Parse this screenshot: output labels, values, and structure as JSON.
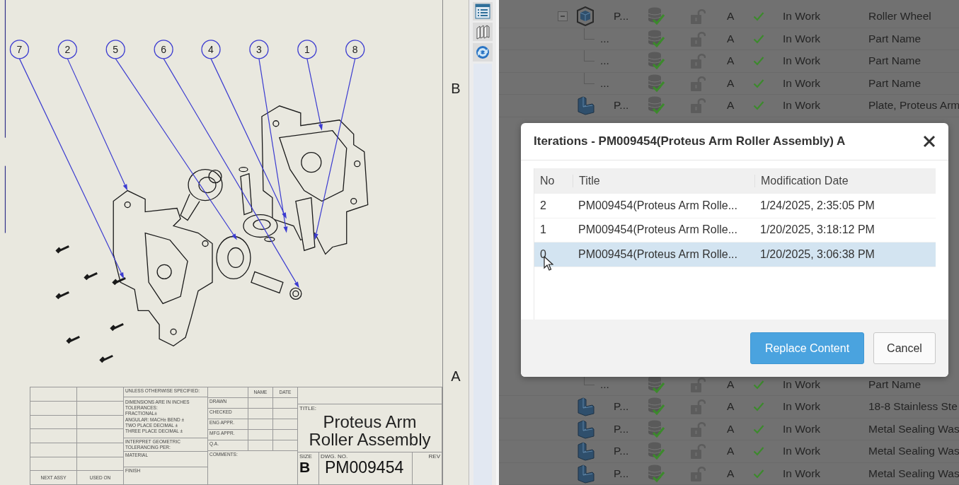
{
  "drawing": {
    "balloons": [
      "7",
      "2",
      "5",
      "6",
      "4",
      "3",
      "1",
      "8"
    ],
    "zones": [
      "B",
      "A"
    ],
    "title_block": {
      "tolerance_heading": "UNLESS OTHERWISE SPECIFIED:",
      "tolerance_notes": [
        "DIMENSIONS ARE IN INCHES",
        "TOLERANCES:",
        "FRACTIONAL±",
        "ANGULAR: MACH±   BEND ±",
        "TWO PLACE DECIMAL   ±",
        "THREE PLACE DECIMAL  ±"
      ],
      "geometric_note": "INTERPRET GEOMETRIC TOLERANCING PER:",
      "material_label": "MATERIAL",
      "finish_label": "FINISH",
      "next_assy_label": "NEXT ASSY",
      "used_on_label": "USED ON",
      "signoff_columns": [
        "NAME",
        "DATE"
      ],
      "signoff_rows": [
        "DRAWN",
        "CHECKED",
        "ENG APPR.",
        "MFG APPR.",
        "Q.A."
      ],
      "comments_label": "COMMENTS:",
      "title_label": "TITLE:",
      "title": "Proteus Arm Roller Assembly",
      "size_label": "SIZE",
      "size": "B",
      "dwg_no_label": "DWG. NO.",
      "dwg_no": "PM009454",
      "rev_label": "REV"
    }
  },
  "tree": {
    "rows_top": [
      {
        "kind": "assembly",
        "name": "P...",
        "revision": "A",
        "status": "In Work",
        "description": "Roller Wheel",
        "expanded": true,
        "children": [
          {
            "kind": "item",
            "name": "...",
            "revision": "A",
            "status": "In Work",
            "description": "Part Name"
          },
          {
            "kind": "item",
            "name": "...",
            "revision": "A",
            "status": "In Work",
            "description": "Part Name"
          },
          {
            "kind": "item",
            "name": "...",
            "revision": "A",
            "status": "In Work",
            "description": "Part Name"
          }
        ]
      },
      {
        "kind": "part",
        "name": "P...",
        "revision": "A",
        "status": "In Work",
        "description": "Plate, Proteus Arm"
      }
    ],
    "rows_bottom": [
      {
        "kind": "item",
        "name": "...",
        "revision": "A",
        "status": "In Work",
        "description": "Part Name"
      },
      {
        "kind": "part",
        "name": "P...",
        "revision": "A",
        "status": "In Work",
        "description": "18-8 Stainless Ste"
      },
      {
        "kind": "part",
        "name": "P...",
        "revision": "A",
        "status": "In Work",
        "description": "Metal Sealing Was"
      },
      {
        "kind": "part",
        "name": "P...",
        "revision": "A",
        "status": "In Work",
        "description": "Metal Sealing Was"
      },
      {
        "kind": "part",
        "name": "P...",
        "revision": "A",
        "status": "In Work",
        "description": "Metal Sealing Was"
      }
    ]
  },
  "dialog": {
    "title": "Iterations - PM009454(Proteus Arm Roller Assembly) A",
    "columns": [
      "No",
      "Title",
      "Modification Date"
    ],
    "rows": [
      {
        "no": "2",
        "title": "PM009454(Proteus Arm Rolle...",
        "date": "1/24/2025, 2:35:05 PM",
        "selected": false
      },
      {
        "no": "1",
        "title": "PM009454(Proteus Arm Rolle...",
        "date": "1/20/2025, 3:18:12 PM",
        "selected": false
      },
      {
        "no": "0",
        "title": "PM009454(Proteus Arm Rolle...",
        "date": "1/20/2025, 3:06:38 PM",
        "selected": true
      }
    ],
    "buttons": [
      {
        "label": "Replace Content",
        "kind": "primary"
      },
      {
        "label": "Cancel",
        "kind": "secondary"
      }
    ]
  }
}
